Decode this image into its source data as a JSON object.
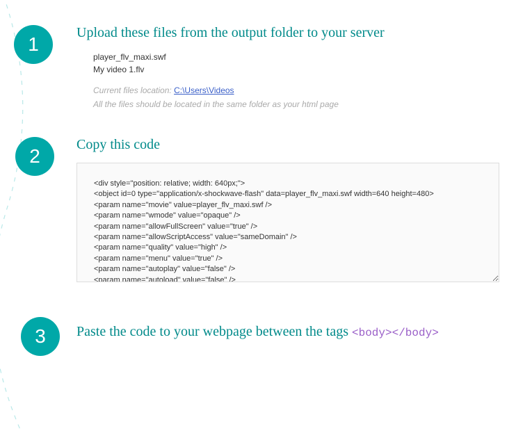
{
  "step1": {
    "number": "1",
    "title": "Upload these files from the output folder to your server",
    "file1": "player_flv_maxi.swf",
    "file2": "My video 1.flv",
    "location_label": "Current files location:  ",
    "location_link": "C:\\Users\\Videos",
    "note": "All the files should be located in the same folder as your html page"
  },
  "step2": {
    "number": "2",
    "title": "Copy this code",
    "code": "<div style=\"position: relative; width: 640px;\">\n<object id=0 type=\"application/x-shockwave-flash\" data=player_flv_maxi.swf width=640 height=480>\n<param name=\"movie\" value=player_flv_maxi.swf />\n<param name=\"wmode\" value=\"opaque\" />\n<param name=\"allowFullScreen\" value=\"true\" />\n<param name=\"allowScriptAccess\" value=\"sameDomain\" />\n<param name=\"quality\" value=\"high\" />\n<param name=\"menu\" value=\"true\" />\n<param name=\"autoplay\" value=\"false\" />\n<param name=\"autoload\" value=\"false\" />"
  },
  "step3": {
    "number": "3",
    "title_text": "Paste the code to your webpage between the tags ",
    "title_code": "<body></body>"
  }
}
